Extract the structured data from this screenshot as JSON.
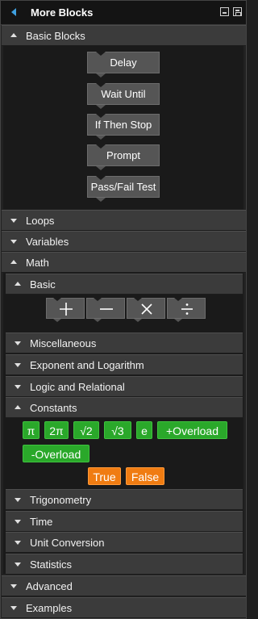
{
  "panel": {
    "title": "More Blocks"
  },
  "sections": {
    "basic_blocks": {
      "label": "Basic Blocks",
      "expanded": true,
      "blocks": [
        "Delay",
        "Wait Until",
        "If Then Stop",
        "Prompt",
        "Pass/Fail Test"
      ]
    },
    "loops": {
      "label": "Loops",
      "expanded": false
    },
    "variables": {
      "label": "Variables",
      "expanded": false
    },
    "math": {
      "label": "Math",
      "expanded": true
    },
    "advanced": {
      "label": "Advanced",
      "expanded": false
    },
    "examples": {
      "label": "Examples",
      "expanded": false
    }
  },
  "math": {
    "basic": {
      "label": "Basic",
      "expanded": true,
      "operators": [
        "plus",
        "minus",
        "times",
        "divide"
      ]
    },
    "miscellaneous": {
      "label": "Miscellaneous"
    },
    "exponent": {
      "label": "Exponent and Logarithm"
    },
    "logic": {
      "label": "Logic and Relational"
    },
    "constants": {
      "label": "Constants",
      "expanded": true,
      "green_buttons": [
        "π",
        "2π",
        "√2",
        "√3",
        "e",
        "+Overload",
        "-Overload"
      ],
      "orange_buttons": [
        "True",
        "False"
      ]
    },
    "trigonometry": {
      "label": "Trigonometry"
    },
    "time": {
      "label": "Time"
    },
    "unit_conversion": {
      "label": "Unit Conversion"
    },
    "statistics": {
      "label": "Statistics"
    }
  },
  "colors": {
    "accent": "#3fa0e0",
    "constant_green": "#2aa82a",
    "boolean_orange": "#f07c12",
    "header": "#3b3b3b",
    "background": "#1a1a1a"
  }
}
